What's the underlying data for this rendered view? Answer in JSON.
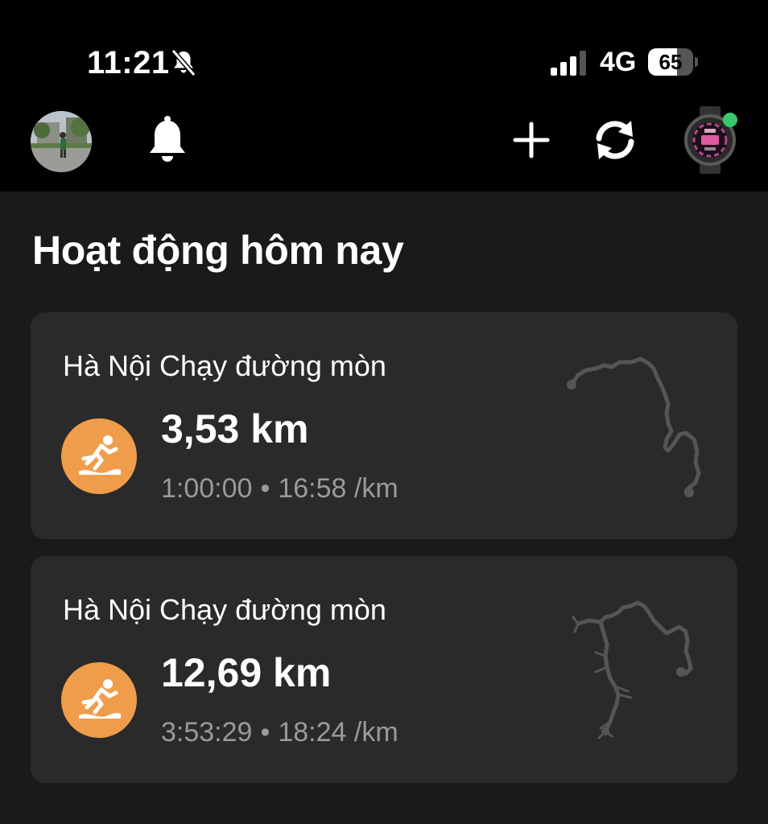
{
  "status_bar": {
    "time": "11:21",
    "network": "4G",
    "battery_level": "65",
    "battery_fraction": 0.65,
    "mute_icon": "bell-slash-icon",
    "signal_icon": "signal-bars-icon"
  },
  "header": {
    "avatar_icon": "profile-avatar",
    "notifications_icon": "bell-icon",
    "add_icon": "plus-icon",
    "sync_icon": "sync-icon",
    "device_icon": "watch-icon",
    "device_status_color": "#39c76b"
  },
  "main": {
    "section_title": "Hoạt động hôm nay",
    "activities": [
      {
        "name": "Hà Nội Chạy đường mòn",
        "distance": "3,53 km",
        "duration": "1:00:00",
        "separator": "•",
        "pace": "16:58 /km",
        "icon": "trail-run-icon"
      },
      {
        "name": "Hà Nội Chạy đường mòn",
        "distance": "12,69 km",
        "duration": "3:53:29",
        "separator": "•",
        "pace": "18:24 /km",
        "icon": "trail-run-icon"
      }
    ]
  },
  "colors": {
    "background": "#1a1a1a",
    "card": "#2a2a2a",
    "accent": "#ef9d4b",
    "secondary_text": "#9a9a9a"
  }
}
